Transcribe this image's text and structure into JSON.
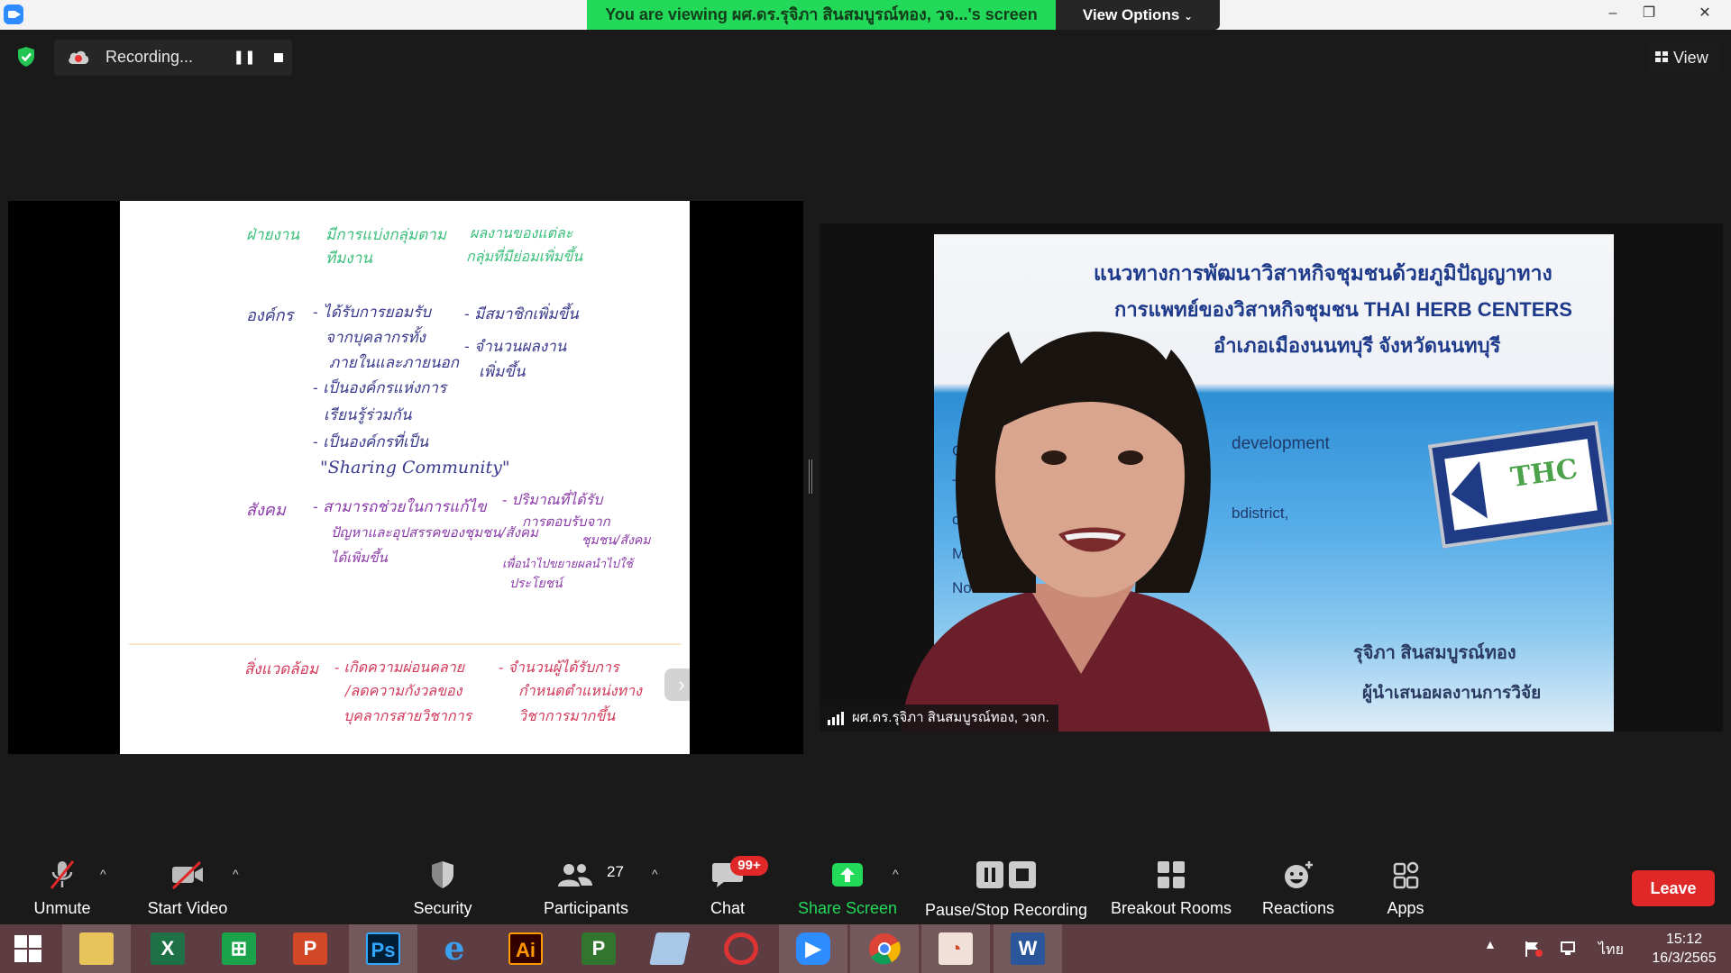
{
  "titlebar": {
    "viewing_banner": "You are viewing ผศ.ดร.รุจิภา สินสมบูรณ์ทอง, วจ...'s screen",
    "view_options": "View Options",
    "minimize": "–",
    "maximize": "❐",
    "close": "✕"
  },
  "top_controls": {
    "recording_text": "Recording...",
    "pause_glyph": "❚❚",
    "view_label": "View"
  },
  "whiteboard": {
    "headers": [
      "ฝ่ายงาน",
      "มีการแบ่งกลุ่มตาม",
      "ทีมงาน",
      "ผลงานของแต่ละ",
      "กลุ่มที่มีย่อมเพิ่มขึ้น"
    ],
    "org_label": "องค์กร",
    "org_items": [
      "- ได้รับการยอมรับ",
      "จากบุคลากรทั้ง",
      "ภายในและภายนอก",
      "- เป็นองค์กรแห่งการ",
      "เรียนรู้ร่วมกัน",
      "- เป็นองค์กรที่เป็น",
      "\"Sharing Community\""
    ],
    "org_right": [
      "- มีสมาชิกเพิ่มขึ้น",
      "- จำนวนผลงาน",
      "เพิ่มขึ้น"
    ],
    "social_label": "สังคม",
    "social_items": [
      "- สามารถช่วยในการแก้ไข",
      "ปัญหาและอุปสรรคของชุมชน/สังคม",
      "ได้เพิ่มขึ้น"
    ],
    "social_right": [
      "- ปริมาณที่ได้รับ",
      "การตอบรับจาก",
      "ชุมชน/สังคม",
      "เพื่อนำไปขยายผลนำไปใช้",
      "ประโยชน์"
    ],
    "env_label": "สิ่งแวดล้อม",
    "env_items": [
      "- เกิดความผ่อนคลาย",
      "/ลดความกังวลของ",
      "บุคลากรสายวิชาการ"
    ],
    "env_right": [
      "- จำนวนผู้ได้รับการ",
      "กำหนดตำแหน่งทาง",
      "วิชาการมากขึ้น"
    ],
    "next_glyph": "›"
  },
  "video": {
    "slide_title1": "แนวทางการพัฒนาวิสาหกิจชุมชนด้วยภูมิปัญญาทาง",
    "slide_title2": "การแพทย์ของวิสาหกิจชุมชน THAI HERB CENTERS",
    "slide_title3": "อำเภอเมืองนนทบุรี จังหวัดนนทบุรี",
    "slide_dev": "development",
    "slide_sub": "bdistrict,",
    "slide_side": [
      "Gu",
      "To",
      "co",
      "Mu",
      "Nont"
    ],
    "slide_name": "รุจิภา สินสมบูรณ์ทอง",
    "slide_role": "ผู้นำเสนอผลงานการวิจัย",
    "sign_text": "THC",
    "participant_name": "ผศ.ดร.รุจิภา สินสมบูรณ์ทอง, วจก."
  },
  "toolbar": {
    "unmute": "Unmute",
    "start_video": "Start Video",
    "security": "Security",
    "participants": "Participants",
    "participant_count": "27",
    "chat": "Chat",
    "chat_badge": "99+",
    "share_screen": "Share Screen",
    "pause_stop_recording": "Pause/Stop Recording",
    "breakout_rooms": "Breakout Rooms",
    "reactions": "Reactions",
    "apps": "Apps",
    "leave": "Leave",
    "caret": "^"
  },
  "taskbar": {
    "apps": [
      "windows-start",
      "file-explorer",
      "excel",
      "store",
      "powerpoint",
      "photoshop",
      "internet-explorer",
      "illustrator",
      "project",
      "notepad",
      "photoscape",
      "zoom",
      "chrome",
      "presentation",
      "word"
    ],
    "language": "ไทย",
    "time": "15:12",
    "date": "16/3/2565"
  },
  "colors": {
    "banner_green": "#23d959",
    "leave_red": "#e02828",
    "taskbar": "#5d3d42"
  }
}
